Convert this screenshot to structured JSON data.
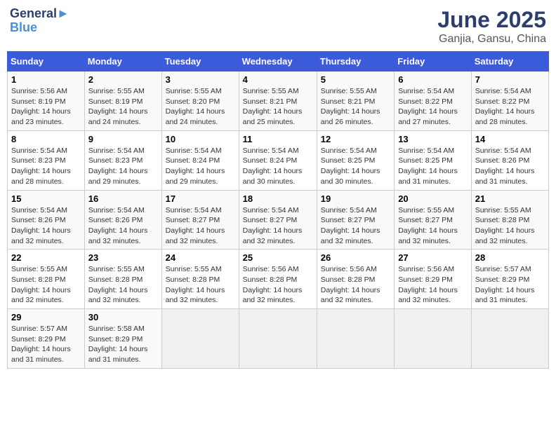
{
  "logo": {
    "line1": "General",
    "line2": "Blue"
  },
  "title": "June 2025",
  "subtitle": "Ganjia, Gansu, China",
  "weekdays": [
    "Sunday",
    "Monday",
    "Tuesday",
    "Wednesday",
    "Thursday",
    "Friday",
    "Saturday"
  ],
  "weeks": [
    [
      {
        "day": "1",
        "info": "Sunrise: 5:56 AM\nSunset: 8:19 PM\nDaylight: 14 hours and 23 minutes."
      },
      {
        "day": "2",
        "info": "Sunrise: 5:55 AM\nSunset: 8:19 PM\nDaylight: 14 hours and 24 minutes."
      },
      {
        "day": "3",
        "info": "Sunrise: 5:55 AM\nSunset: 8:20 PM\nDaylight: 14 hours and 24 minutes."
      },
      {
        "day": "4",
        "info": "Sunrise: 5:55 AM\nSunset: 8:21 PM\nDaylight: 14 hours and 25 minutes."
      },
      {
        "day": "5",
        "info": "Sunrise: 5:55 AM\nSunset: 8:21 PM\nDaylight: 14 hours and 26 minutes."
      },
      {
        "day": "6",
        "info": "Sunrise: 5:54 AM\nSunset: 8:22 PM\nDaylight: 14 hours and 27 minutes."
      },
      {
        "day": "7",
        "info": "Sunrise: 5:54 AM\nSunset: 8:22 PM\nDaylight: 14 hours and 28 minutes."
      }
    ],
    [
      {
        "day": "8",
        "info": "Sunrise: 5:54 AM\nSunset: 8:23 PM\nDaylight: 14 hours and 28 minutes."
      },
      {
        "day": "9",
        "info": "Sunrise: 5:54 AM\nSunset: 8:23 PM\nDaylight: 14 hours and 29 minutes."
      },
      {
        "day": "10",
        "info": "Sunrise: 5:54 AM\nSunset: 8:24 PM\nDaylight: 14 hours and 29 minutes."
      },
      {
        "day": "11",
        "info": "Sunrise: 5:54 AM\nSunset: 8:24 PM\nDaylight: 14 hours and 30 minutes."
      },
      {
        "day": "12",
        "info": "Sunrise: 5:54 AM\nSunset: 8:25 PM\nDaylight: 14 hours and 30 minutes."
      },
      {
        "day": "13",
        "info": "Sunrise: 5:54 AM\nSunset: 8:25 PM\nDaylight: 14 hours and 31 minutes."
      },
      {
        "day": "14",
        "info": "Sunrise: 5:54 AM\nSunset: 8:26 PM\nDaylight: 14 hours and 31 minutes."
      }
    ],
    [
      {
        "day": "15",
        "info": "Sunrise: 5:54 AM\nSunset: 8:26 PM\nDaylight: 14 hours and 32 minutes."
      },
      {
        "day": "16",
        "info": "Sunrise: 5:54 AM\nSunset: 8:26 PM\nDaylight: 14 hours and 32 minutes."
      },
      {
        "day": "17",
        "info": "Sunrise: 5:54 AM\nSunset: 8:27 PM\nDaylight: 14 hours and 32 minutes."
      },
      {
        "day": "18",
        "info": "Sunrise: 5:54 AM\nSunset: 8:27 PM\nDaylight: 14 hours and 32 minutes."
      },
      {
        "day": "19",
        "info": "Sunrise: 5:54 AM\nSunset: 8:27 PM\nDaylight: 14 hours and 32 minutes."
      },
      {
        "day": "20",
        "info": "Sunrise: 5:55 AM\nSunset: 8:27 PM\nDaylight: 14 hours and 32 minutes."
      },
      {
        "day": "21",
        "info": "Sunrise: 5:55 AM\nSunset: 8:28 PM\nDaylight: 14 hours and 32 minutes."
      }
    ],
    [
      {
        "day": "22",
        "info": "Sunrise: 5:55 AM\nSunset: 8:28 PM\nDaylight: 14 hours and 32 minutes."
      },
      {
        "day": "23",
        "info": "Sunrise: 5:55 AM\nSunset: 8:28 PM\nDaylight: 14 hours and 32 minutes."
      },
      {
        "day": "24",
        "info": "Sunrise: 5:55 AM\nSunset: 8:28 PM\nDaylight: 14 hours and 32 minutes."
      },
      {
        "day": "25",
        "info": "Sunrise: 5:56 AM\nSunset: 8:28 PM\nDaylight: 14 hours and 32 minutes."
      },
      {
        "day": "26",
        "info": "Sunrise: 5:56 AM\nSunset: 8:28 PM\nDaylight: 14 hours and 32 minutes."
      },
      {
        "day": "27",
        "info": "Sunrise: 5:56 AM\nSunset: 8:29 PM\nDaylight: 14 hours and 32 minutes."
      },
      {
        "day": "28",
        "info": "Sunrise: 5:57 AM\nSunset: 8:29 PM\nDaylight: 14 hours and 31 minutes."
      }
    ],
    [
      {
        "day": "29",
        "info": "Sunrise: 5:57 AM\nSunset: 8:29 PM\nDaylight: 14 hours and 31 minutes."
      },
      {
        "day": "30",
        "info": "Sunrise: 5:58 AM\nSunset: 8:29 PM\nDaylight: 14 hours and 31 minutes."
      },
      null,
      null,
      null,
      null,
      null
    ]
  ]
}
